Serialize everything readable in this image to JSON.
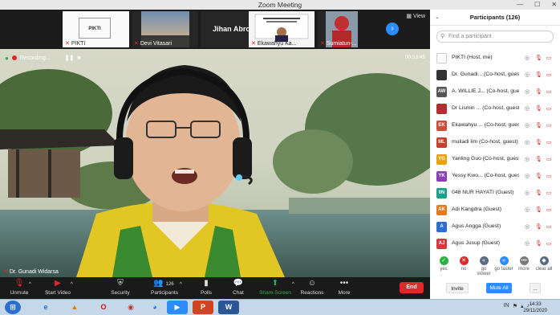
{
  "window": {
    "title": "Zoom Meeting"
  },
  "thumbnails": [
    {
      "name": "PIKTI",
      "slide_text": "PIKTI"
    },
    {
      "name": "Devi Vitasari"
    },
    {
      "name": "Jihan Abrori"
    },
    {
      "name": "Ekawahyu Ka..."
    },
    {
      "name": "Sumiatun-..."
    }
  ],
  "view_button": "View",
  "main_video": {
    "recording_label": "Recording...",
    "elapsed": "00:53:45",
    "speaker": "Dr. Gunadi Widarsa"
  },
  "toolbar": {
    "unmute": "Unmute",
    "start_video": "Start Video",
    "security": "Security",
    "participants": "Participants",
    "participant_count": "126",
    "polls": "Polls",
    "chat": "Chat",
    "share_screen": "Share Screen",
    "reactions": "Reactions",
    "more": "More",
    "end": "End"
  },
  "panel": {
    "title": "Participants (126)",
    "search_placeholder": "Find a participant",
    "participants": [
      {
        "initials": "",
        "name": "PIKTI (Host, me)",
        "color": "#ffffff"
      },
      {
        "initials": "",
        "name": "Dr. Gunadi... (Co-host, guest)",
        "color": "#333333"
      },
      {
        "initials": "AW",
        "name": "A. WILLIE J... (Co-host, guest)",
        "color": "#555555"
      },
      {
        "initials": "",
        "name": "Dr Lismin ... (Co-host, guest)",
        "color": "#b03030"
      },
      {
        "initials": "EK",
        "name": "Ekawahyu ... (Co-host, guest)",
        "color": "#d24a3a"
      },
      {
        "initials": "ML",
        "name": "muliadi lim (Co-host, guest)",
        "color": "#c8402c"
      },
      {
        "initials": "YG",
        "name": "Yanling Guo (Co-host, guest)",
        "color": "#e8a20c"
      },
      {
        "initials": "YK",
        "name": "Yessy Kwo... (Co-host, guest)",
        "color": "#8b3fb5"
      },
      {
        "initials": "0N",
        "name": "048 NUR HAYATI (Guest)",
        "color": "#17a287"
      },
      {
        "initials": "AK",
        "name": "Adi Kangdra (Guest)",
        "color": "#e07b22"
      },
      {
        "initials": "A",
        "name": "Agus Angga (Guest)",
        "color": "#2d6fd1"
      },
      {
        "initials": "AJ",
        "name": "Agus Jusup (Guest)",
        "color": "#d23b3b"
      }
    ],
    "reactions": [
      {
        "label": "yes",
        "symbol": "✓",
        "color": "#2cae43"
      },
      {
        "label": "no",
        "symbol": "✕",
        "color": "#e02828"
      },
      {
        "label": "go slower",
        "symbol": "«",
        "color": "#5b6b80"
      },
      {
        "label": "go faster",
        "symbol": "»",
        "color": "#2d8cff"
      },
      {
        "label": "more",
        "symbol": "•••",
        "color": "#7a7a7a"
      },
      {
        "label": "clear all",
        "symbol": "◆",
        "color": "#5b6b80"
      }
    ],
    "invite": "Invite",
    "mute_all": "Mute All",
    "more": "..."
  },
  "taskbar": {
    "time": "14:33",
    "date": "29/11/2020",
    "lang": "IN"
  }
}
